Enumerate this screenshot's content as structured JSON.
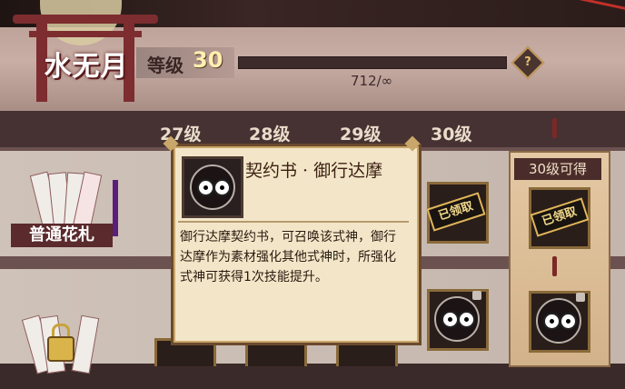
{
  "player": {
    "name": "水无月"
  },
  "level": {
    "label": "等级",
    "value": "30",
    "xp_text": "712/∞",
    "xp_progress": 0
  },
  "help_icon": {
    "glyph": "?"
  },
  "levels": [
    "27级",
    "28级",
    "29级",
    "30级"
  ],
  "categories": [
    {
      "label": "普通花札"
    }
  ],
  "rewards": {
    "claimed_label": "已领取",
    "plaque_label": "30级可得"
  },
  "tooltip": {
    "title": "契约书 · 御行达摩",
    "description": "御行达摩契约书，可召唤该式神，御行达摩作为素材强化其他式神时，所强化式神可获得1次技能提升。"
  },
  "colors": {
    "accent": "#c9a66a",
    "dark_red": "#7d2d2f",
    "tooltip_bg": "#f3e6c8"
  }
}
